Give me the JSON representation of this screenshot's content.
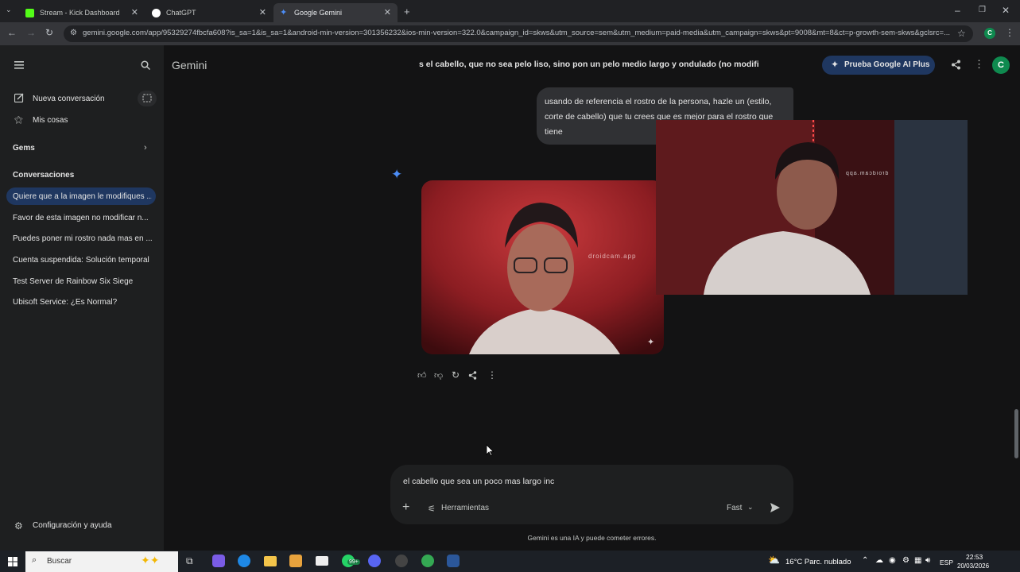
{
  "browser": {
    "tabs": [
      {
        "title": "Stream - Kick Dashboard",
        "color": "#53fc18"
      },
      {
        "title": "ChatGPT",
        "color": "#ffffff"
      },
      {
        "title": "Google Gemini",
        "color": "#4c8df6"
      }
    ],
    "url": "gemini.google.com/app/95329274fbcfa608?is_sa=1&is_sa=1&android-min-version=301356232&ios-min-version=322.0&campaign_id=skws&utm_source=sem&utm_medium=paid-media&utm_campaign=skws&pt=9008&mt=8&ct=p-growth-sem-skws&gclsrc=..."
  },
  "sidebar": {
    "new_chat": "Nueva conversación",
    "my_stuff": "Mis cosas",
    "gems": "Gems",
    "conversations_heading": "Conversaciones",
    "conversations": [
      "Quiere que a la imagen le modifiques ...",
      "Favor de esta imagen no modificar n...",
      "Puedes poner mi rostro nada mas en ...",
      "Cuenta suspendida: Solución temporal",
      "Test Server de Rainbow Six Siege",
      "Ubisoft Service: ¿Es Normal?"
    ],
    "settings": "Configuración y ayuda"
  },
  "header": {
    "app_name": "Gemini",
    "chat_title": "s el cabello, que no sea pelo liso, sino pon un pelo medio largo y ondulado (no modifi",
    "upgrade_button": "Prueba Google AI Plus",
    "avatar_letter": "C"
  },
  "chat": {
    "user_message": "usando de referencia el rostro de la persona, hazle un (estilo, corte de cabello) que tu crees que es mejor para el rostro que tiene",
    "image_watermark": "droidcam.app"
  },
  "composer": {
    "input_value": "el cabello que sea un poco mas largo inc",
    "tools_label": "Herramientas",
    "model_label": "Fast",
    "disclaimer": "Gemini es una IA y puede cometer errores."
  },
  "taskbar": {
    "search_placeholder": "Buscar",
    "weather": "16°C  Parc. nublado",
    "language": "ESP",
    "time": "22:53",
    "date": "20/03/2026",
    "notification_count": "99+"
  },
  "colors": {
    "accent_blue": "#4c8df6",
    "active_conversation": "#1f3760",
    "avatar_green": "#0f8a4f"
  }
}
